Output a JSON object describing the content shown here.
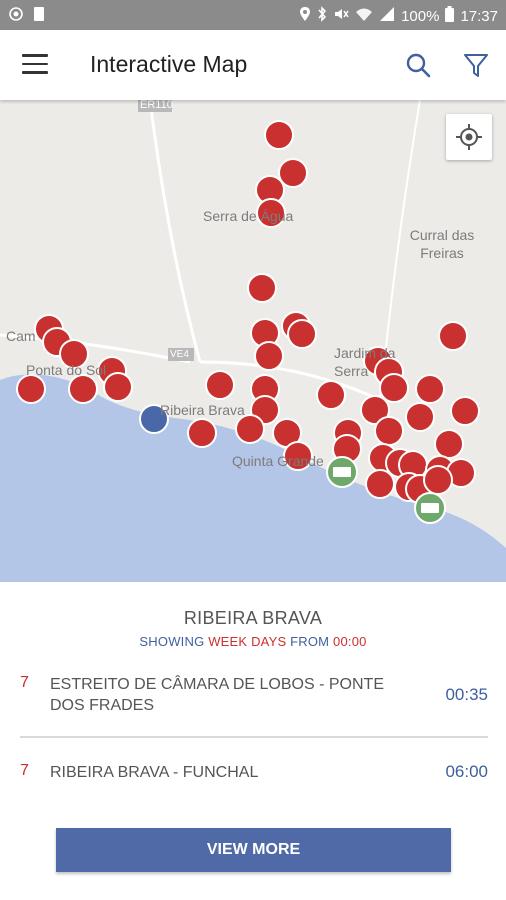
{
  "status_bar": {
    "battery": "100%",
    "time": "17:37",
    "left_icons": [
      "sync-icon",
      "sd-card-icon"
    ],
    "right_icons": [
      "location-icon",
      "bluetooth-icon",
      "mute-icon",
      "wifi-icon",
      "signal-icon"
    ]
  },
  "app_bar": {
    "title": "Interactive Map",
    "menu_icon": "menu-icon",
    "search_icon": "search-icon",
    "filter_icon": "filter-icon"
  },
  "map": {
    "labels": {
      "er110": "ER110",
      "serra": "Serra de Água",
      "curral": "Curral das Freiras",
      "campanario": "Cam",
      "ponta": "Ponta do Sol",
      "ve4": "VE4",
      "ribeira": "Ribeira Brava",
      "jardim": "Jardim da Serra",
      "quinta": "Quinta Grande"
    },
    "colors": {
      "stop": "#c8312f",
      "selected_stop": "#4a67a8",
      "station": "#6fa86b",
      "sea": "#b4c6e7",
      "land": "#ecebe8"
    }
  },
  "panel": {
    "stop_name": "RIBEIRA BRAVA",
    "showing": {
      "prefix": "SHOWING",
      "days": "WEEK DAYS",
      "from": "FROM",
      "time": "00:00"
    },
    "routes": [
      {
        "number": "7",
        "description": "ESTREITO DE CÂMARA DE LOBOS - PONTE DOS FRADES",
        "time": "00:35"
      },
      {
        "number": "7",
        "description": "RIBEIRA BRAVA - FUNCHAL",
        "time": "06:00"
      }
    ],
    "view_more": "VIEW MORE"
  }
}
